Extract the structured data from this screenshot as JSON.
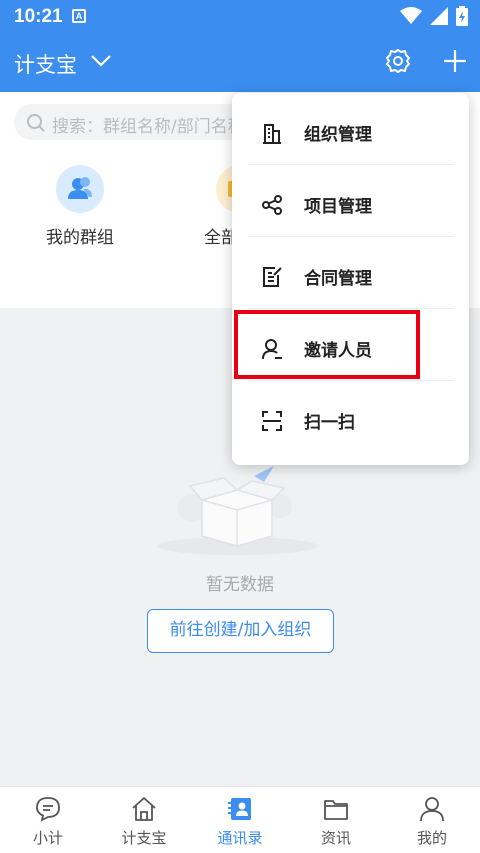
{
  "status_bar": {
    "time": "10:21",
    "notification_badge": "A"
  },
  "header": {
    "title": "计支宝"
  },
  "search": {
    "placeholder": "搜索：群组名称/部门名称"
  },
  "quick_actions": [
    {
      "label": "我的群组",
      "icon": "group-icon"
    },
    {
      "label": "全部",
      "icon": "folder-icon"
    }
  ],
  "empty_state": {
    "message": "暂无数据",
    "button_label": "前往创建/加入组织"
  },
  "dropdown_menu": {
    "items": [
      {
        "label": "组织管理",
        "icon": "building-icon"
      },
      {
        "label": "项目管理",
        "icon": "share-nodes-icon"
      },
      {
        "label": "合同管理",
        "icon": "contract-icon"
      },
      {
        "label": "邀请人员",
        "icon": "invite-user-icon",
        "highlighted": true
      },
      {
        "label": "扫一扫",
        "icon": "scan-icon"
      }
    ]
  },
  "bottom_nav": {
    "items": [
      {
        "label": "小计",
        "icon": "chat-icon",
        "active": false
      },
      {
        "label": "计支宝",
        "icon": "home-icon",
        "active": false
      },
      {
        "label": "通讯录",
        "icon": "contacts-icon",
        "active": true
      },
      {
        "label": "资讯",
        "icon": "news-icon",
        "active": false
      },
      {
        "label": "我的",
        "icon": "profile-icon",
        "active": false
      }
    ]
  },
  "colors": {
    "primary": "#3b8df0",
    "highlight": "#e60012",
    "background_gray": "#f0f1f3"
  }
}
